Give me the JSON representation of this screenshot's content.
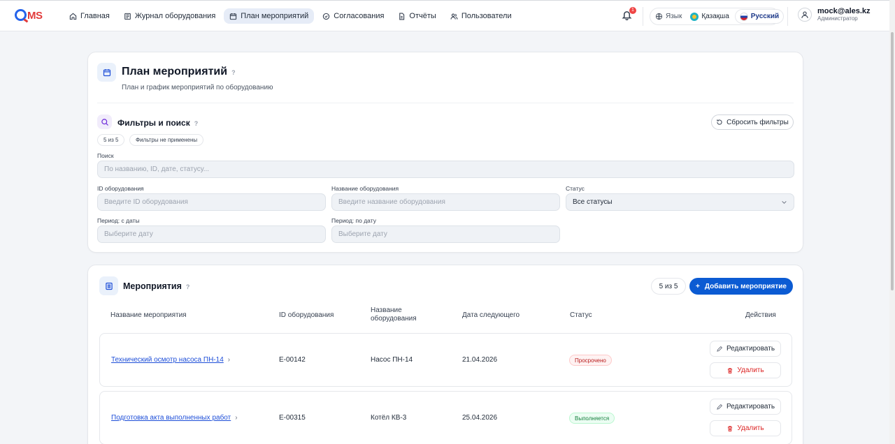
{
  "header": {
    "logo": "MS",
    "nav": [
      {
        "label": "Главная",
        "icon": "home-icon"
      },
      {
        "label": "Журнал оборудования",
        "icon": "journal-icon"
      },
      {
        "label": "План мероприятий",
        "icon": "calendar-icon",
        "active": true
      },
      {
        "label": "Согласования",
        "icon": "check-circle-icon"
      },
      {
        "label": "Отчёты",
        "icon": "document-icon"
      },
      {
        "label": "Пользователи",
        "icon": "users-icon"
      }
    ],
    "notifications_count": "1",
    "language_label": "Язык",
    "languages": [
      "Қазақша",
      "Русский"
    ],
    "user_email": "mock@ales.kz",
    "user_role": "Администратор"
  },
  "page": {
    "title": "План мероприятий",
    "help": "?",
    "subtitle": "План и график мероприятий по оборудованию"
  },
  "filters": {
    "title": "Фильтры и поиск",
    "help": "?",
    "reset_label": "Сбросить фильтры",
    "count_chip": "5 из 5",
    "applied_chip": "Фильтры не применены",
    "search_label": "Поиск",
    "search_placeholder": "По названию, ID, дате, статусу...",
    "equipment_id_label": "ID оборудования",
    "equipment_id_placeholder": "Введите ID оборудования",
    "equipment_name_label": "Название оборудования",
    "equipment_name_placeholder": "Введите название оборудования",
    "status_label": "Статус",
    "status_value": "Все статусы",
    "date_from_label": "Период: с даты",
    "date_from_placeholder": "Выберите дату",
    "date_to_label": "Период: по дату",
    "date_to_placeholder": "Выберите дату"
  },
  "events": {
    "title": "Мероприятия",
    "help": "?",
    "count": "5 из 5",
    "add_label": "Добавить мероприятие",
    "columns": {
      "name": "Название мероприятия",
      "equipment_id": "ID оборудования",
      "equipment_name_1": "Название",
      "equipment_name_2": "оборудования",
      "next_date": "Дата следующего",
      "status": "Статус",
      "actions": "Действия"
    },
    "edit_label": "Редактировать",
    "delete_label": "Удалить",
    "rows": [
      {
        "name": "Технический осмотр насоса ПН-14",
        "equipment_id": "E-00142",
        "equipment_name": "Насос ПН-14",
        "next_date": "21.04.2026",
        "status": "Просрочено",
        "status_type": "overdue"
      },
      {
        "name": "Подготовка акта выполненных работ",
        "equipment_id": "E-00315",
        "equipment_name": "Котёл КВ-3",
        "next_date": "25.04.2026",
        "status": "Выполняется",
        "status_type": "progress"
      }
    ]
  },
  "colors": {
    "accent": "#0b5bd3",
    "overdue": "#b91c1c",
    "in_progress": "#15803d"
  }
}
